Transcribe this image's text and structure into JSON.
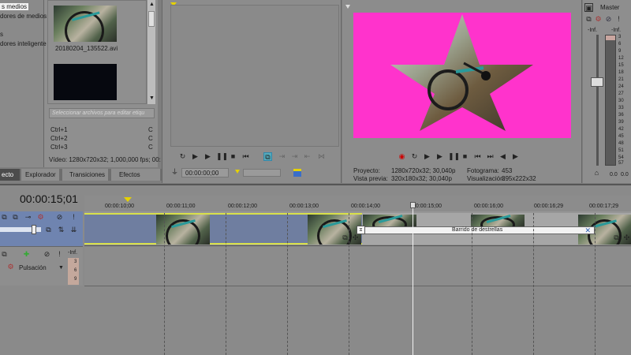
{
  "media": {
    "tree_items": [
      "s medios",
      "dores de medios",
      "s",
      "dores inteligente"
    ],
    "file_name": "20180204_135522.avi",
    "tag_placeholder": "Seleccionar archivos para editar etiqu",
    "shortcuts": [
      {
        "key": "Ctrl+1",
        "val": "C"
      },
      {
        "key": "Ctrl+2",
        "val": "C"
      },
      {
        "key": "Ctrl+3",
        "val": "C"
      }
    ],
    "video_info": "Vídeo: 1280x720x32; 1,000,000 fps; 00:"
  },
  "tabs": [
    {
      "label": "ecto"
    },
    {
      "label": "Explorador"
    },
    {
      "label": "Transiciones"
    },
    {
      "label": "Efectos"
    }
  ],
  "trimmer": {
    "time": "00:00:00;00"
  },
  "preview": {
    "project_label": "Proyecto:",
    "project_value": "1280x720x32; 30,040p",
    "preview_label": "Vista previa:",
    "preview_value": "320x180x32; 30,040p",
    "frame_label": "Fotograma:",
    "frame_value": "453",
    "display_label": "Visualización:",
    "display_value": "395x222x32",
    "bg_color": "#ff33cc"
  },
  "master": {
    "title": "Master",
    "db_left": "-Inf.",
    "db_right": "-Inf.",
    "scale": [
      "3",
      "6",
      "9",
      "12",
      "15",
      "18",
      "21",
      "24",
      "27",
      "30",
      "33",
      "36",
      "39",
      "42",
      "45",
      "48",
      "51",
      "54",
      "57"
    ],
    "bottom_left": "0.0",
    "bottom_right": "0.0"
  },
  "timeline": {
    "current_time": "00:00:15;01",
    "ruler": [
      "00:00:10;00",
      "00:00:11;00",
      "00:00:12;00",
      "00:00:13;00",
      "00:00:14;00",
      "00:00:15;00",
      "00:00:16;00",
      "00:00:16;29",
      "00:00:17;29"
    ],
    "transition_label": "Barrido de destrellas",
    "audio_track_fx": "Pulsación",
    "audio_db": "-Inf.",
    "audio_meter": [
      "3",
      "6",
      "9"
    ]
  }
}
